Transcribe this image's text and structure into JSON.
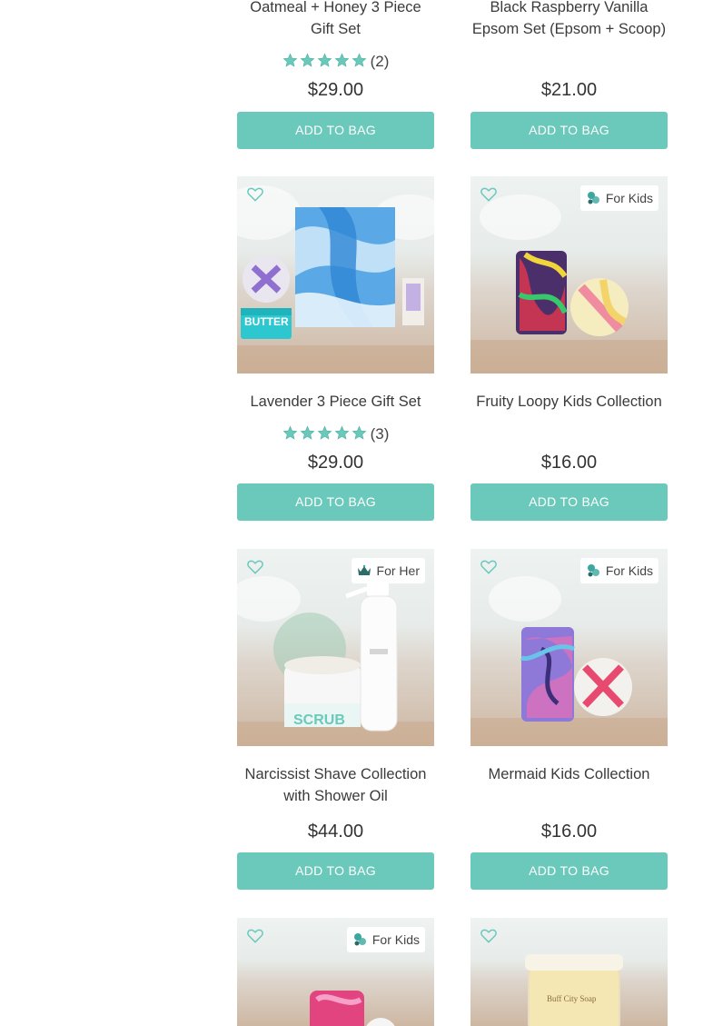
{
  "products": [
    {
      "title": "Oatmeal + Honey 3 Piece Gift Set",
      "rating_count": "(2)",
      "price": "$29.00",
      "button": "ADD TO BAG"
    },
    {
      "title": "Black Raspberry Vanilla Epsom Set (Epsom + Scoop)",
      "price": "$21.00",
      "button": "ADD TO BAG"
    },
    {
      "title": "Lavender 3 Piece Gift Set",
      "rating_count": "(3)",
      "price": "$29.00",
      "button": "ADD TO BAG"
    },
    {
      "title": "Fruity Loopy Kids Collection",
      "tag": "For Kids",
      "price": "$16.00",
      "button": "ADD TO BAG"
    },
    {
      "title": "Narcissist Shave Collection with Shower Oil",
      "tag": "For Her",
      "price": "$44.00",
      "button": "ADD TO BAG"
    },
    {
      "title": "Mermaid Kids Collection",
      "tag": "For Kids",
      "price": "$16.00",
      "button": "ADD TO BAG"
    },
    {
      "tag": "For Kids"
    },
    {}
  ],
  "image_text": {
    "butter": "BUTTER",
    "scrub": "SCRUB",
    "brand_mark": "Buff City Soap"
  },
  "colors": {
    "accent": "#6bc9bb",
    "star": "#6bc9bb",
    "heart": "#6bc9bb"
  },
  "icons": {
    "wishlist": "heart-outline-icon",
    "kids": "bubbles-icon",
    "her": "crown-icon",
    "rating": "star-icon"
  }
}
